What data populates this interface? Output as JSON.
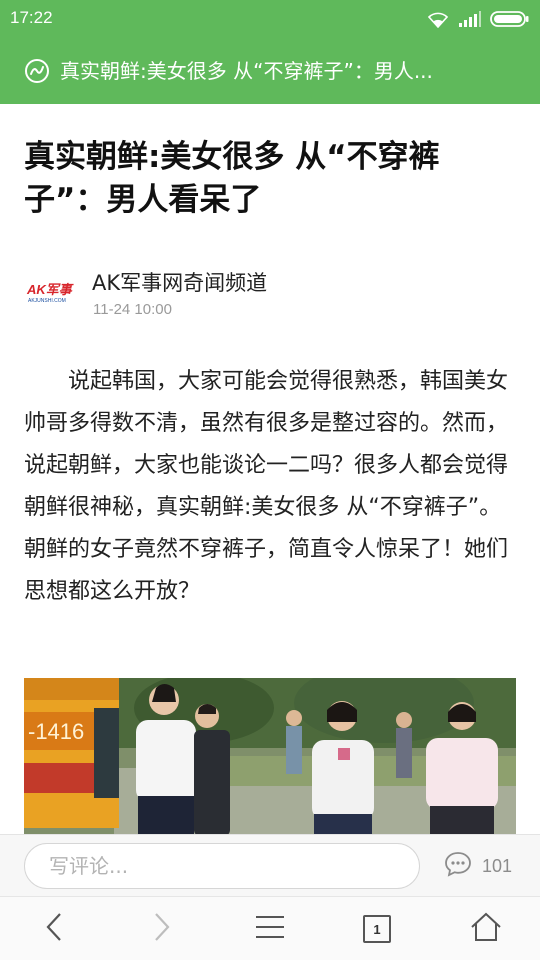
{
  "status_bar": {
    "time": "17:22",
    "icons": [
      "wifi-icon",
      "signal-icon",
      "battery-icon"
    ]
  },
  "title_bar": {
    "icon": "site-logo-icon",
    "title": "真实朝鲜:美女很多 从“不穿裤子”：男人..."
  },
  "article": {
    "title": "真实朝鲜:美女很多 从“不穿裤子”：男人看呆了",
    "source": {
      "logo_text": "AK军事",
      "logo_subtext": "AKJUNSHI.COM",
      "name": "AK军事网奇闻频道",
      "time": "11-24 10:00"
    },
    "body": "说起韩国，大家可能会觉得很熟悉，韩国美女帅哥多得数不清，虽然有很多是整过容的。然而，说起朝鲜，大家也能谈论一二吗？很多人都会觉得朝鲜很神秘，真实朝鲜:美女很多 从“不穿裤子”。朝鲜的女子竟然不穿裤子，简直令人惊呆了！她们思想都这么开放？",
    "photo": {
      "bus_number": "-1416"
    }
  },
  "comment_bar": {
    "placeholder": "写评论...",
    "count": "101"
  },
  "nav_bar": {
    "tabs_count": "1",
    "icons": [
      "back-icon",
      "forward-icon",
      "menu-icon",
      "tabs-icon",
      "home-icon"
    ]
  },
  "colors": {
    "accent": "#5fb95b",
    "logo_red": "#d8262c",
    "logo_blue": "#1b4fa0"
  }
}
